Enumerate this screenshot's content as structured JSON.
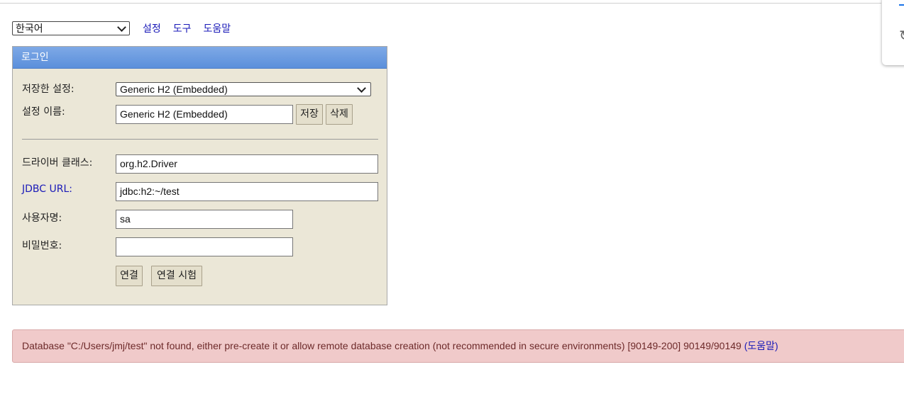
{
  "toolbar": {
    "language_selected": "한국어",
    "links": [
      "설정",
      "도구",
      "도움말"
    ]
  },
  "login": {
    "header": "로그인",
    "saved_settings_label": "저장한 설정:",
    "saved_settings_value": "Generic H2 (Embedded)",
    "setting_name_label": "설정 이름:",
    "setting_name_value": "Generic H2 (Embedded)",
    "save_button": "저장",
    "delete_button": "삭제",
    "driver_class_label": "드라이버 클래스:",
    "driver_class_value": "org.h2.Driver",
    "jdbc_url_label": "JDBC URL:",
    "jdbc_url_value": "jdbc:h2:~/test",
    "username_label": "사용자명:",
    "username_value": "sa",
    "password_label": "비밀번호:",
    "password_value": "",
    "connect_button": "연결",
    "test_connection_button": "연결 시험"
  },
  "error": {
    "message": "Database \"C:/Users/jmj/test\" not found, either pre-create it or allow remote database creation (not recommended in secure environments) [90149-200] 90149/90149",
    "help_link": "(도움말)"
  },
  "colors": {
    "panel_bg": "#ebe7d7",
    "header_blue": "#5b8fdb",
    "link_blue": "#1a1ab8",
    "error_bg": "#f0caca"
  }
}
